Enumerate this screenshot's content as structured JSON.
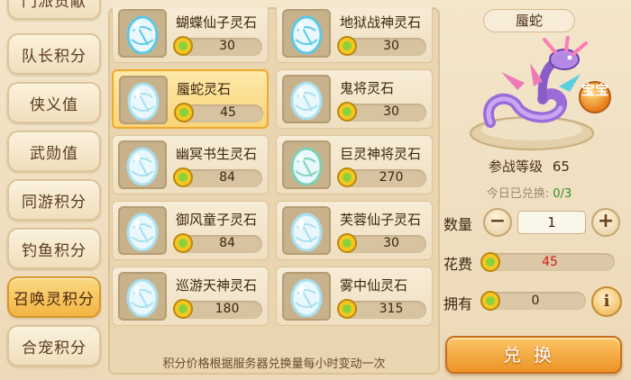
{
  "tabs": [
    {
      "label": "门派贡献",
      "active": false
    },
    {
      "label": "队长积分",
      "active": false
    },
    {
      "label": "侠义值",
      "active": false
    },
    {
      "label": "武勋值",
      "active": false
    },
    {
      "label": "同游积分",
      "active": false
    },
    {
      "label": "钓鱼积分",
      "active": false
    },
    {
      "label": "召唤灵积分",
      "active": true
    },
    {
      "label": "合宠积分",
      "active": false
    }
  ],
  "items": [
    {
      "name": "蝴蝶仙子灵石",
      "price": "30",
      "selected": false,
      "egg_color": "#5cc8e8"
    },
    {
      "name": "地狱战神灵石",
      "price": "30",
      "selected": false,
      "egg_color": "#5cc8e8"
    },
    {
      "name": "蜃蛇灵石",
      "price": "45",
      "selected": true,
      "egg_color": "#a9dff0"
    },
    {
      "name": "鬼将灵石",
      "price": "30",
      "selected": false,
      "egg_color": "#a9dff0"
    },
    {
      "name": "幽冥书生灵石",
      "price": "84",
      "selected": false,
      "egg_color": "#a9dff0"
    },
    {
      "name": "巨灵神将灵石",
      "price": "270",
      "selected": false,
      "egg_color": "#7fd1b6"
    },
    {
      "name": "御风童子灵石",
      "price": "84",
      "selected": false,
      "egg_color": "#a9dff0"
    },
    {
      "name": "芙蓉仙子灵石",
      "price": "30",
      "selected": false,
      "egg_color": "#a9dff0"
    },
    {
      "name": "巡游天神灵石",
      "price": "180",
      "selected": false,
      "egg_color": "#a9dff0"
    },
    {
      "name": "雾中仙灵石",
      "price": "315",
      "selected": false,
      "egg_color": "#a9dff0"
    }
  ],
  "notice": "积分价格根据服务器兑换量每小时变动一次",
  "detail": {
    "pet_name": "蜃蛇",
    "badge": "宝宝",
    "level_label": "参战等级",
    "level_value": "65",
    "today_label": "今日已兑换:",
    "today_value": "0/3",
    "quantity_label": "数量",
    "quantity_value": "1",
    "minus": "−",
    "plus": "+",
    "cost_label": "花费",
    "cost_value": "45",
    "own_label": "拥有",
    "own_value": "0",
    "info": "i",
    "exchange_label": "兑换"
  },
  "colors": {
    "cost_text": "#d21f1f",
    "active_tab": "#f2b443",
    "exchange_button": "#ee9326",
    "coin": "#f6c623"
  }
}
